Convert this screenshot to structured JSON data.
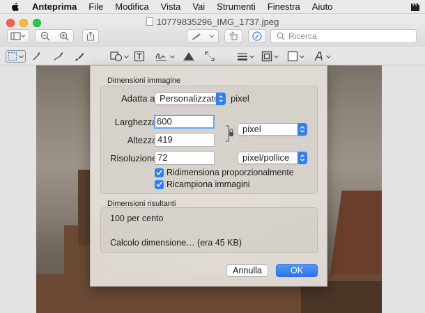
{
  "menubar": {
    "app_name": "Anteprima",
    "items": [
      "File",
      "Modifica",
      "Vista",
      "Vai",
      "Strumenti",
      "Finestra",
      "Aiuto"
    ]
  },
  "window": {
    "title": "10779835296_IMG_1737.jpeg",
    "search_placeholder": "Ricerca"
  },
  "dialog": {
    "image_dimensions_title": "Dimensioni immagine",
    "fit_label": "Adatta a:",
    "fit_value": "Personalizzato",
    "fit_unit": "pixel",
    "width_label": "Larghezza:",
    "width_value": "600",
    "height_label": "Altezza:",
    "height_value": "419",
    "size_unit": "pixel",
    "resolution_label": "Risoluzione:",
    "resolution_value": "72",
    "resolution_unit": "pixel/pollice",
    "scale_proportionally": "Ridimensiona proporzionalmente",
    "resample": "Ricampiona immagini",
    "result_title": "Dimensioni risultanti",
    "result_percent": "100 per cento",
    "result_size": "Calcolo dimensione… (era 45 KB)",
    "cancel_label": "Annulla",
    "ok_label": "OK"
  },
  "colors": {
    "accent": "#2f7ff6",
    "close": "#ff5f57",
    "minimize": "#febc2e",
    "zoom": "#28c840"
  }
}
